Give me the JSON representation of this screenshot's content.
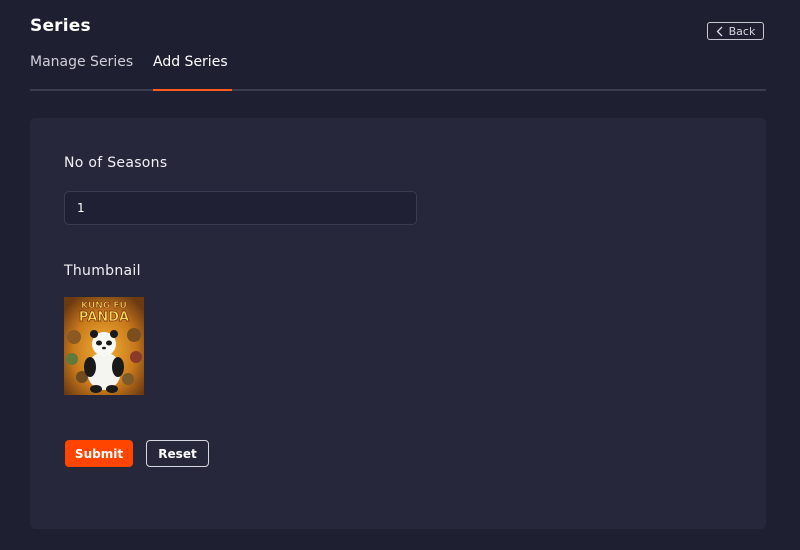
{
  "header": {
    "title": "Series",
    "back_label": "Back",
    "back_icon": "chevron-left-icon"
  },
  "tabs": [
    {
      "label": "Manage Series",
      "active": false
    },
    {
      "label": "Add Series",
      "active": true
    }
  ],
  "form": {
    "seasons_label": "No of Seasons",
    "seasons_value": "1",
    "thumbnail_label": "Thumbnail",
    "thumbnail_title_line1": "KUNG FU",
    "thumbnail_title_line2": "PANDA",
    "submit_label": "Submit",
    "reset_label": "Reset"
  },
  "colors": {
    "background": "#1e1f30",
    "card": "#26273a",
    "accent": "#ff4500",
    "tab_underline": "#ff5a1f"
  }
}
